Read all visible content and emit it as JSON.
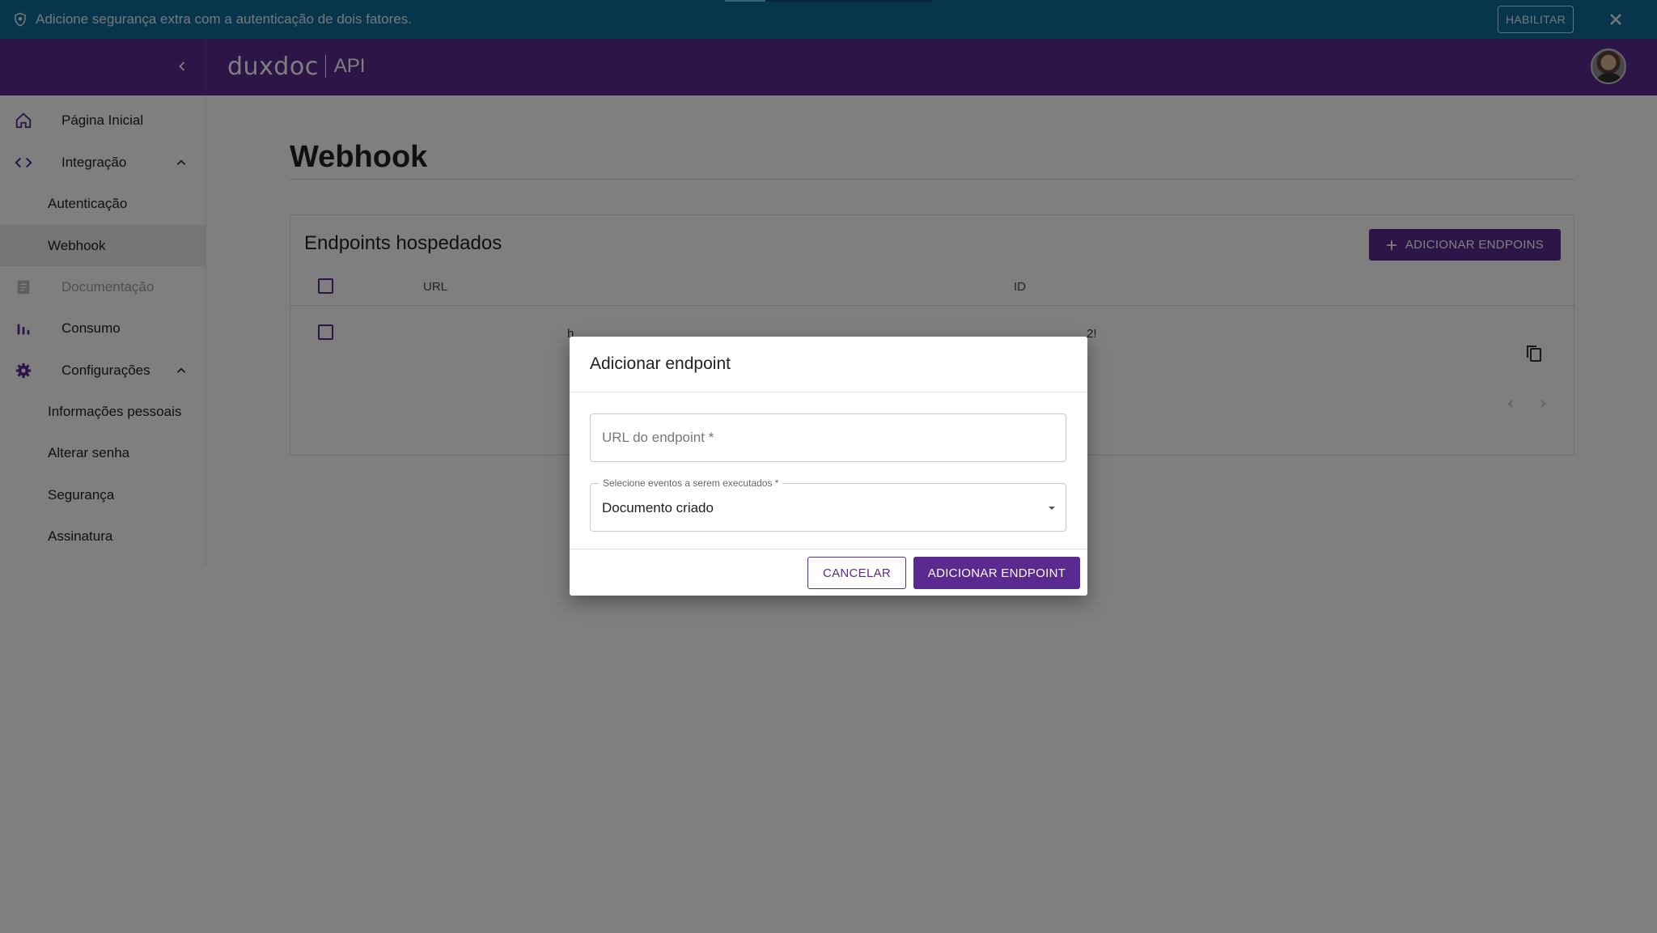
{
  "banner": {
    "message": "Adicione segurança extra com a autenticação de dois fatores.",
    "enable_label": "HABILITAR",
    "icon": "shield-icon",
    "close_icon": "close-icon"
  },
  "header": {
    "brand": "duxdoc",
    "product": "API",
    "collapse_icon": "chevron-left-icon",
    "avatar": "user-avatar"
  },
  "sidebar": {
    "items": [
      {
        "label": "Página Inicial",
        "icon": "home-icon"
      },
      {
        "label": "Integração",
        "icon": "code-icon",
        "expanded": true
      },
      {
        "label": "Autenticação",
        "sub": true
      },
      {
        "label": "Webhook",
        "sub": true,
        "active": true
      },
      {
        "label": "Documentação",
        "icon": "document-icon",
        "disabled": true
      },
      {
        "label": "Consumo",
        "icon": "bar-chart-icon"
      },
      {
        "label": "Configurações",
        "icon": "gear-icon",
        "expanded": true
      },
      {
        "label": "Informações pessoais",
        "sub": true
      },
      {
        "label": "Alterar senha",
        "sub": true
      },
      {
        "label": "Segurança",
        "sub": true
      },
      {
        "label": "Assinatura",
        "sub": true
      }
    ]
  },
  "main": {
    "title": "Webhook",
    "card": {
      "title": "Endpoints hospedados",
      "add_button_label": "ADICIONAR ENDPOINS",
      "columns": [
        "URL",
        "ID"
      ],
      "row_partial_left": "h",
      "row_partial_right": "2!"
    }
  },
  "dialog": {
    "title": "Adicionar endpoint",
    "url_field": {
      "placeholder": "URL do endpoint *",
      "value": ""
    },
    "events_field": {
      "label": "Selecione eventos a serem executados *",
      "value": "Documento criado"
    },
    "cancel_label": "CANCELAR",
    "submit_label": "ADICIONAR ENDPOINT"
  },
  "colors": {
    "primary": "#5b2a91",
    "banner": "#0e6a99",
    "overlay": "rgba(0,0,0,0.5)"
  }
}
